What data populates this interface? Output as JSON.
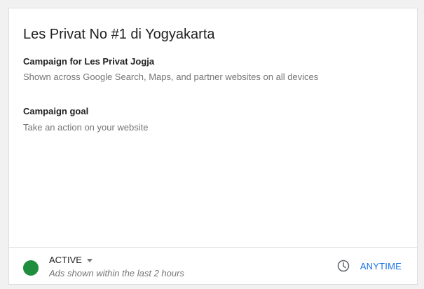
{
  "campaign": {
    "title": "Les Privat No #1 di Yogyakarta",
    "name_label": "Campaign for Les Privat Jogja",
    "name_sub": "Shown across Google Search, Maps, and partner websites on all devices",
    "goal_label": "Campaign goal",
    "goal_sub": "Take an action on your website"
  },
  "status": {
    "label": "ACTIVE",
    "sub": "Ads shown within the last 2 hours",
    "color": "#1e8e3e"
  },
  "schedule": {
    "label": "ANYTIME",
    "icon": "clock-icon",
    "color": "#1a73e8"
  }
}
